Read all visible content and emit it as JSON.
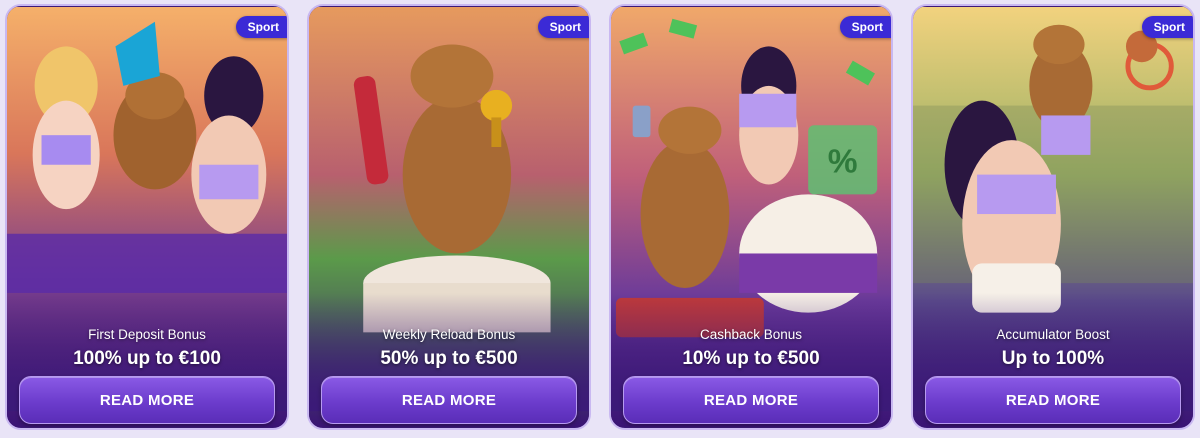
{
  "cards": [
    {
      "badge": "Sport",
      "title": "First Deposit Bonus",
      "amount": "100% up to €100",
      "cta": "READ MORE"
    },
    {
      "badge": "Sport",
      "title": "Weekly Reload Bonus",
      "amount": "50% up to €500",
      "cta": "READ MORE"
    },
    {
      "badge": "Sport",
      "title": "Cashback Bonus",
      "amount": "10% up to €500",
      "cta": "READ MORE"
    },
    {
      "badge": "Sport",
      "title": "Accumulator Boost",
      "amount": "Up to 100%",
      "cta": "READ MORE"
    }
  ],
  "colors": {
    "accent": "#6c3ccc",
    "badge": "#3b2ad6",
    "border": "#c9b8f1",
    "page": "#e9e4f7"
  },
  "icons": [
    "capybara-mascot-illustration",
    "player-illustration",
    "trophy-icon",
    "firecracker-icon",
    "cake-illustration",
    "basketball-hoop-illustration"
  ]
}
